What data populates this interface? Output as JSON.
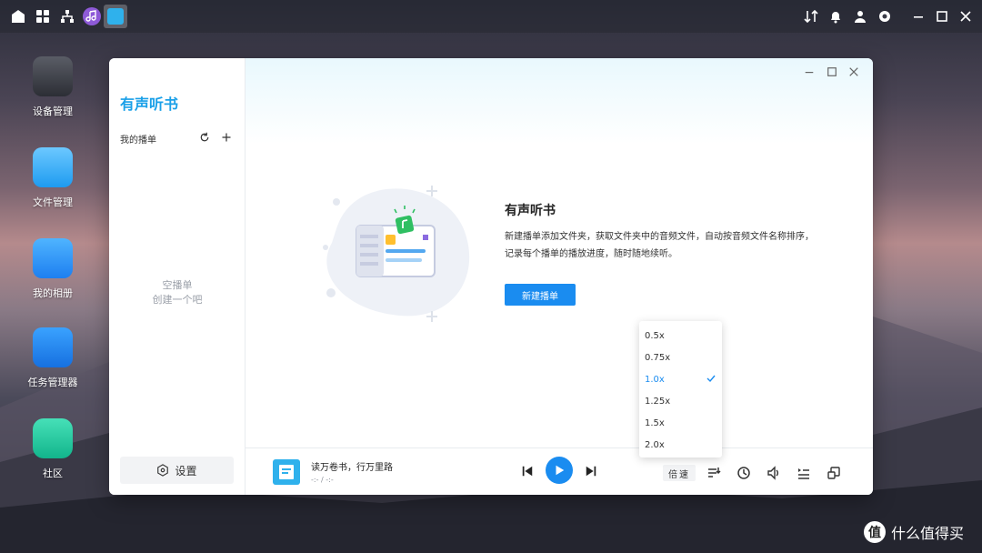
{
  "desktop": {
    "icons": [
      {
        "label": "设备管理"
      },
      {
        "label": "文件管理"
      },
      {
        "label": "我的相册"
      },
      {
        "label": "任务管理器"
      },
      {
        "label": "社区"
      }
    ]
  },
  "window": {
    "app_title": "有声听书",
    "sidebar": {
      "playlist_label": "我的播单",
      "empty_line1": "空播单",
      "empty_line2": "创建一个吧",
      "settings_label": "设置"
    },
    "main": {
      "title": "有声听书",
      "description": "新建播单添加文件夹，获取文件夹中的音频文件，自动按音频文件名称排序，记录每个播单的播放进度，随时随地续听。",
      "new_button": "新建播单"
    },
    "player": {
      "track_title": "读万卷书，行万里路",
      "track_time": "-:- / -:-",
      "speed_label": "倍速"
    }
  },
  "speed_menu": {
    "options": [
      "0.5x",
      "0.75x",
      "1.0x",
      "1.25x",
      "1.5x",
      "2.0x"
    ],
    "selected": "1.0x"
  },
  "watermark": {
    "text": "什么值得买",
    "logo_char": "值"
  },
  "colors": {
    "accent": "#1a8cf0",
    "title": "#1aa0e8"
  }
}
